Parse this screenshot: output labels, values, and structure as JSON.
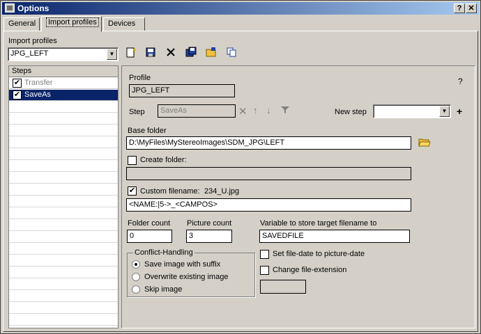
{
  "window": {
    "title": "Options",
    "help_btn": "?",
    "close_btn": "✕"
  },
  "tabs": [
    {
      "label": "General"
    },
    {
      "label": "Import profiles"
    },
    {
      "label": "Devices"
    }
  ],
  "import_profiles": {
    "label": "Import profiles",
    "selected": "JPG_LEFT",
    "toolbar_icons": [
      "new-icon",
      "save-icon",
      "delete-icon",
      "save-as-icon",
      "open-folder-icon",
      "copy-icon"
    ]
  },
  "steps": {
    "header": "Steps",
    "items": [
      {
        "label": "Transfer",
        "checked": true,
        "selected": false
      },
      {
        "label": "SaveAs",
        "checked": true,
        "selected": true
      }
    ]
  },
  "profile": {
    "label": "Profile",
    "value": "JPG_LEFT",
    "help": "?"
  },
  "step": {
    "label": "Step",
    "value": "SaveAs",
    "new_step_label": "New step",
    "new_step_value": "",
    "add": "+"
  },
  "base_folder": {
    "label": "Base folder",
    "value": "D:\\MyFiles\\MyStereoImages\\SDM_JPG\\LEFT"
  },
  "create_folder": {
    "label": "Create folder:",
    "checked": false,
    "value": ""
  },
  "custom_filename": {
    "label": "Custom filename:",
    "checked": true,
    "preview": "234_U.jpg",
    "value": "<NAME:|5->_<CAMPOS>"
  },
  "folder_count": {
    "label": "Folder count",
    "value": "0"
  },
  "picture_count": {
    "label": "Picture count",
    "value": "3"
  },
  "variable": {
    "label": "Variable to store target filename to",
    "value": "SAVEDFILE"
  },
  "conflict": {
    "title": "Conflict-Handling",
    "options": [
      {
        "label": "Save image with suffix",
        "selected": true
      },
      {
        "label": "Overwrite existing image",
        "selected": false
      },
      {
        "label": "Skip image",
        "selected": false
      }
    ]
  },
  "set_file_date": {
    "label": "Set file-date to picture-date",
    "checked": false
  },
  "change_ext": {
    "label": "Change file-extension",
    "checked": false,
    "value": ""
  }
}
